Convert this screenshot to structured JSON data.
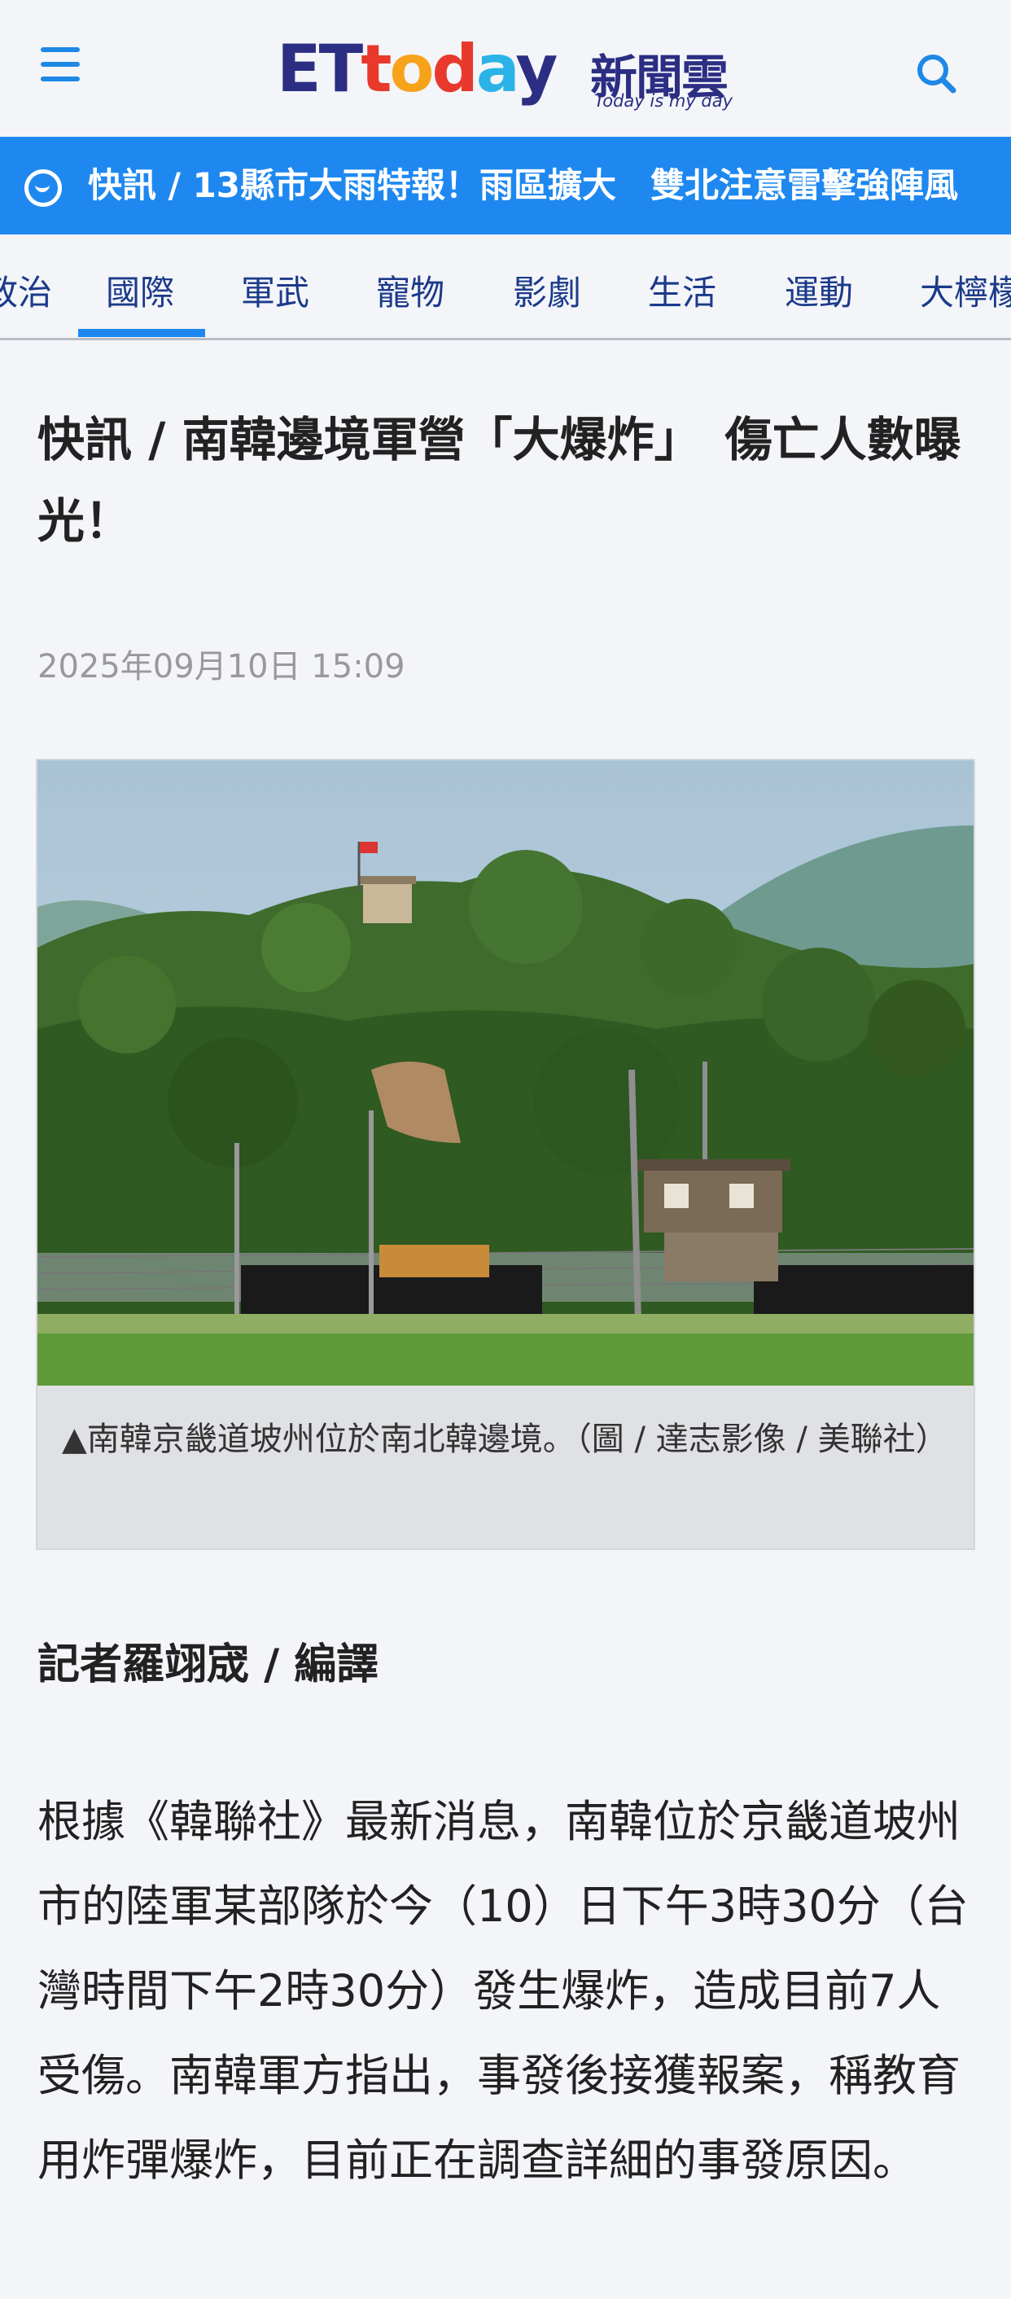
{
  "header": {
    "menu_icon": "hamburger-menu-icon",
    "search_icon": "search-icon",
    "logo": {
      "word_et": "ET",
      "word_t": "t",
      "word_o": "o",
      "word_d": "d",
      "word_a": "a",
      "word_y": "y",
      "name_cn": "新聞雲",
      "tagline": "Today is my day"
    }
  },
  "breaking": {
    "icon": "smile-circle-icon",
    "text": "快訊 / 13縣市大雨特報！雨區擴大　雙北注意雷擊強陣風"
  },
  "categories": [
    {
      "label": "政治"
    },
    {
      "label": "國際"
    },
    {
      "label": "軍武"
    },
    {
      "label": "寵物"
    },
    {
      "label": "影劇"
    },
    {
      "label": "生活"
    },
    {
      "label": "運動"
    },
    {
      "label": "大檸檬"
    }
  ],
  "active_category": "國際",
  "article": {
    "title": "快訊 / 南韓邊境軍營「大爆炸」　傷亡人數曝光！",
    "date": "2025年09月10日 15:09",
    "image_caption": "▲南韓京畿道坡州位於南北韓邊境。（圖 / 達志影像 / 美聯社）",
    "byline": "記者羅翊宬 / 編譯",
    "body": "根據《韓聯社》最新消息，南韓位於京畿道坡州市的陸軍某部隊於今（10）日下午3時30分（台灣時間下午2時30分）發生爆炸，造成目前7人受傷。南韓軍方指出，事發後接獲報案，稱教育用炸彈爆炸，目前正在調查詳細的事發原因。"
  },
  "colors": {
    "accent_blue": "#1e88f0",
    "nav_text": "#1b3a8a",
    "logo_navy": "#2b2e83"
  }
}
